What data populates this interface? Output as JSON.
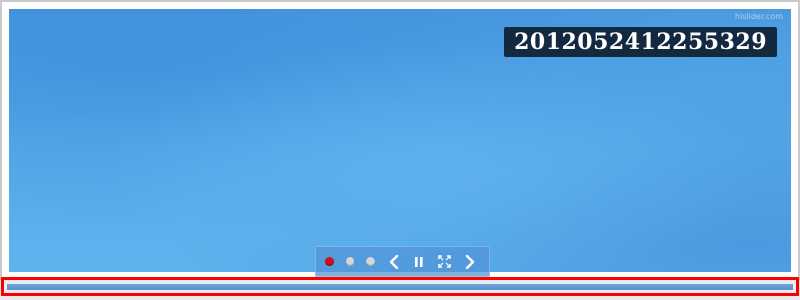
{
  "slider": {
    "caption": "2012052412255329",
    "watermark": "hislider.com",
    "active_slide": 1,
    "slide_count": 3
  },
  "controls": {
    "dots": [
      {
        "state": "active",
        "color": "#d0101a"
      },
      {
        "state": "inactive",
        "color": "#d7d7d7"
      },
      {
        "state": "inactive",
        "color": "#d7d7d7"
      }
    ],
    "buttons": [
      "chevron-left-icon",
      "pause-icon",
      "fullscreen-icon",
      "chevron-right-icon"
    ]
  },
  "progress": {
    "highlight_color": "#ff0000",
    "fill_color": "#5b92c8"
  },
  "colors": {
    "slide_blue": "#5aaeea",
    "caption_bg": "#0a1928"
  }
}
